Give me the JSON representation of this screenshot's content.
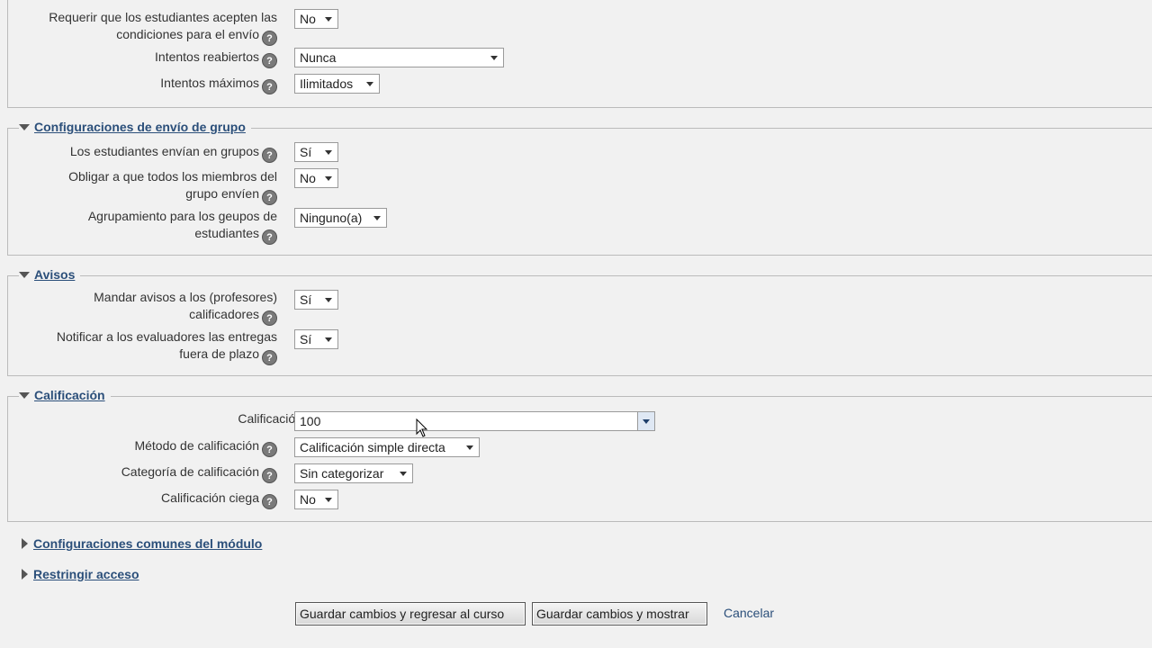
{
  "top_section": {
    "rows": [
      {
        "label": "Requerir que los estudiantes acepten las condiciones para el envío",
        "value": "No"
      },
      {
        "label": "Intentos reabiertos",
        "value": "Nunca"
      },
      {
        "label": "Intentos máximos",
        "value": "Ilimitados"
      }
    ]
  },
  "group_section": {
    "title": "Configuraciones de envío de grupo",
    "rows": [
      {
        "label": "Los estudiantes envían en grupos",
        "value": "Sí"
      },
      {
        "label": "Obligar a que todos los miembros del grupo envíen",
        "value": "No"
      },
      {
        "label": "Agrupamiento para los geupos de estudiantes",
        "value": "Ninguno(a)"
      }
    ]
  },
  "notices_section": {
    "title": "Avisos",
    "rows": [
      {
        "label": "Mandar avisos a los (profesores) calificadores",
        "value": "Sí"
      },
      {
        "label": "Notificar a los evaluadores las entregas fuera de plazo",
        "value": "Sí"
      }
    ]
  },
  "grade_section": {
    "title": "Calificación",
    "rows": [
      {
        "label": "Calificación",
        "value": "100"
      },
      {
        "label": "Método de calificación",
        "value": "Calificación simple directa"
      },
      {
        "label": "Categoría de calificación",
        "value": "Sin categorizar"
      },
      {
        "label": "Calificación ciega",
        "value": "No"
      }
    ]
  },
  "collapsed_sections": [
    {
      "title": "Configuraciones comunes del módulo"
    },
    {
      "title": "Restringir acceso"
    }
  ],
  "buttons": {
    "save_return": "Guardar cambios y regresar al curso",
    "save_show": "Guardar cambios y mostrar",
    "cancel": "Cancelar"
  },
  "icons": {
    "help": "help-icon",
    "expand": "triangle-down-icon",
    "collapse": "triangle-right-icon"
  },
  "colors": {
    "link": "#2b4f7a",
    "background": "#f1f1f1"
  }
}
